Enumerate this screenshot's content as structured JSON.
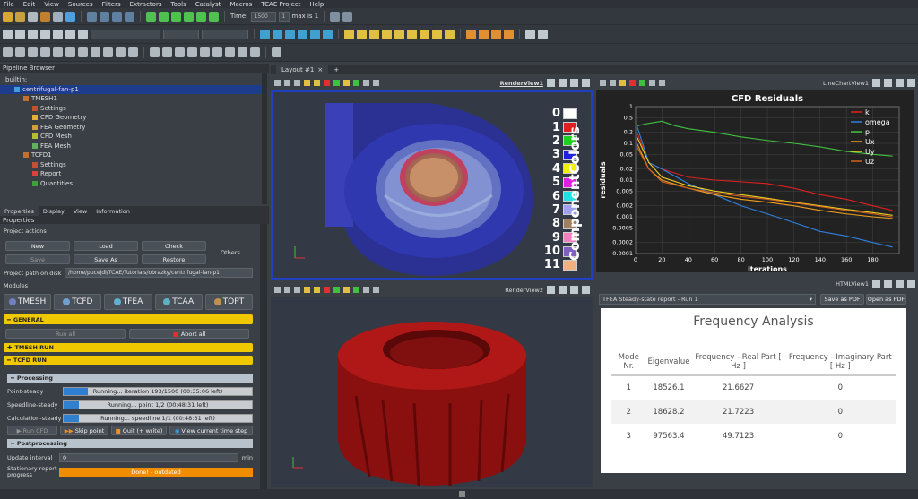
{
  "menu": [
    "File",
    "Edit",
    "View",
    "Sources",
    "Filters",
    "Extractors",
    "Tools",
    "Catalyst",
    "Macros",
    "TCAE Project",
    "Help"
  ],
  "toolbar": {
    "time_label": "Time:",
    "time_value": "1500",
    "step_value": "1",
    "max_label": "max is 1"
  },
  "pipeline": {
    "title": "Pipeline Browser",
    "items": [
      {
        "label": "builtin:",
        "depth": 0,
        "color": ""
      },
      {
        "label": "centrifugal-fan-p1",
        "depth": 1,
        "color": "#3fa0e0"
      },
      {
        "label": "TMESH1",
        "depth": 2,
        "color": "#c07030"
      },
      {
        "label": "Settings",
        "depth": 3,
        "color": "#c05030"
      },
      {
        "label": "CFD Geometry",
        "depth": 3,
        "color": "#e0b030"
      },
      {
        "label": "FEA Geometry",
        "depth": 3,
        "color": "#d0a040"
      },
      {
        "label": "CFD Mesh",
        "depth": 3,
        "color": "#b0c030"
      },
      {
        "label": "FEA Mesh",
        "depth": 3,
        "color": "#60b060"
      },
      {
        "label": "TCFD1",
        "depth": 2,
        "color": "#c07030"
      },
      {
        "label": "Settings",
        "depth": 3,
        "color": "#c05030"
      },
      {
        "label": "Report",
        "depth": 3,
        "color": "#e04040"
      },
      {
        "label": "Quantities",
        "depth": 3,
        "color": "#40a040"
      }
    ]
  },
  "tabs": [
    "Properties",
    "Display",
    "View",
    "Information"
  ],
  "properties": {
    "title": "Properties",
    "project_actions": "Project actions",
    "buttons": {
      "new": "New",
      "load": "Load",
      "check": "Check",
      "others": "Others",
      "save": "Save",
      "save_as": "Save As",
      "restore": "Restore"
    },
    "path_label": "Project path on disk",
    "path_value": "/home/pucejdl/TCAE/Tutorials/obrazky/centrifugal-fan-p1",
    "modules_label": "Modules",
    "modules": [
      "TMESH",
      "TCFD",
      "TFEA",
      "TCAA",
      "TOPT"
    ],
    "general": "GENERAL",
    "run_all": "Run all",
    "abort_all": "Abort all",
    "tmesh_run": "TMESH RUN",
    "tcfd_run": "TCFD RUN",
    "processing": "Processing",
    "point_steady_label": "Point-steady",
    "point_steady_status": "Running... iteration 193/1500 (00:35:06 left)",
    "point_steady_progress": 0.13,
    "speedline_label": "Speedline-steady",
    "speedline_status": "Running... point 1/2 (00:48:31 left)",
    "speedline_progress": 0.08,
    "calc_label": "Calculation-steady",
    "calc_status": "Running... speedline 1/1 (00:48:31 left)",
    "calc_progress": 0.08,
    "run_cfd": "Run CFD",
    "skip_point": "Skip point",
    "quit_write": "Quit (+ write)",
    "view_current": "View current time step",
    "postprocessing": "Postprocessing",
    "update_interval_label": "Update interval",
    "update_interval_value": "0",
    "update_interval_unit": "min",
    "stationary_label": "Stationary report progress",
    "stationary_status": "Done! - outdated"
  },
  "layout_tab": "Layout #1",
  "render_view1": "RenderView1",
  "render_view2": "RenderView2",
  "linechart_view": "LineChartView1",
  "html_view": "HTMLView1",
  "component_colors": {
    "title": "ComponentColors",
    "entries": [
      {
        "label": "0",
        "color": "#ffffff"
      },
      {
        "label": "1",
        "color": "#e02020"
      },
      {
        "label": "2",
        "color": "#20d020"
      },
      {
        "label": "3",
        "color": "#2020e0"
      },
      {
        "label": "4",
        "color": "#f0f000"
      },
      {
        "label": "5",
        "color": "#e020e0"
      },
      {
        "label": "6",
        "color": "#20e0e0"
      },
      {
        "label": "7",
        "color": "#a0a0f0"
      },
      {
        "label": "8",
        "color": "#a08060"
      },
      {
        "label": "9",
        "color": "#f080c0"
      },
      {
        "label": "10",
        "color": "#8060c0"
      },
      {
        "label": "11",
        "color": "#f0b080"
      }
    ]
  },
  "chart_data": {
    "type": "line",
    "title": "CFD Residuals",
    "xlabel": "iterations",
    "ylabel": "residuals",
    "xlim": [
      0,
      200
    ],
    "ylim": [
      0.0001,
      1
    ],
    "log_y": true,
    "grid": true,
    "legend": "top-right",
    "xticks": [
      0,
      20,
      40,
      60,
      80,
      100,
      120,
      140,
      160,
      180
    ],
    "yticks": [
      "1",
      "0.5",
      "0.2",
      "0.1",
      "0.05",
      "0.02",
      "0.01",
      "0.005",
      "0.002",
      "0.001",
      "0.0005",
      "0.0002",
      "0.0001"
    ],
    "yticks_vals": [
      1,
      0.5,
      0.2,
      0.1,
      0.05,
      0.02,
      0.01,
      0.005,
      0.002,
      0.001,
      0.0005,
      0.0002,
      0.0001
    ],
    "series": [
      {
        "name": "k",
        "color": "#e02020",
        "x": [
          1,
          10,
          20,
          40,
          60,
          80,
          100,
          120,
          140,
          160,
          180,
          195
        ],
        "y": [
          0.2,
          0.03,
          0.02,
          0.012,
          0.01,
          0.009,
          0.008,
          0.006,
          0.004,
          0.003,
          0.002,
          0.0015
        ]
      },
      {
        "name": "omega",
        "color": "#3080e0",
        "x": [
          1,
          10,
          20,
          40,
          60,
          80,
          100,
          120,
          140,
          160,
          180,
          195
        ],
        "y": [
          0.3,
          0.03,
          0.02,
          0.008,
          0.004,
          0.002,
          0.0012,
          0.0007,
          0.0004,
          0.0003,
          0.0002,
          0.00015
        ]
      },
      {
        "name": "p",
        "color": "#40c040",
        "x": [
          1,
          10,
          20,
          30,
          40,
          60,
          80,
          100,
          120,
          140,
          160,
          180,
          195
        ],
        "y": [
          0.3,
          0.35,
          0.4,
          0.3,
          0.25,
          0.2,
          0.15,
          0.12,
          0.1,
          0.08,
          0.06,
          0.05,
          0.045
        ]
      },
      {
        "name": "Ux",
        "color": "#f0a020",
        "x": [
          1,
          10,
          20,
          40,
          60,
          80,
          100,
          120,
          140,
          160,
          180,
          195
        ],
        "y": [
          0.1,
          0.02,
          0.01,
          0.006,
          0.004,
          0.003,
          0.0025,
          0.002,
          0.0015,
          0.0012,
          0.001,
          0.0009
        ]
      },
      {
        "name": "Uy",
        "color": "#f0d020",
        "x": [
          1,
          10,
          20,
          40,
          60,
          80,
          100,
          120,
          140,
          160,
          180,
          195
        ],
        "y": [
          0.15,
          0.03,
          0.012,
          0.007,
          0.005,
          0.004,
          0.0032,
          0.0025,
          0.002,
          0.0016,
          0.0013,
          0.0011
        ]
      },
      {
        "name": "Uz",
        "color": "#d06020",
        "x": [
          1,
          10,
          20,
          40,
          60,
          80,
          100,
          120,
          140,
          160,
          180,
          195
        ],
        "y": [
          0.08,
          0.02,
          0.009,
          0.006,
          0.0045,
          0.0036,
          0.003,
          0.0024,
          0.0019,
          0.0015,
          0.0012,
          0.001
        ]
      }
    ]
  },
  "report": {
    "selector": "TFEA Steady-state report - Run 1",
    "save_pdf": "Save as PDF",
    "open_pdf": "Open as PDF",
    "title": "Frequency Analysis",
    "headers": [
      "Mode Nr.",
      "Eigenvalue",
      "Frequency - Real Part [ Hz ]",
      "Frequency - Imaginary Part [ Hz ]"
    ],
    "rows": [
      [
        "1",
        "18526.1",
        "21.6627",
        "0"
      ],
      [
        "2",
        "18628.2",
        "21.7223",
        "0"
      ],
      [
        "3",
        "97563.4",
        "49.7123",
        "0"
      ]
    ]
  },
  "colors": {
    "accent": "#f0c800",
    "selection": "#1e3c8c",
    "orange": "#f08c00"
  }
}
